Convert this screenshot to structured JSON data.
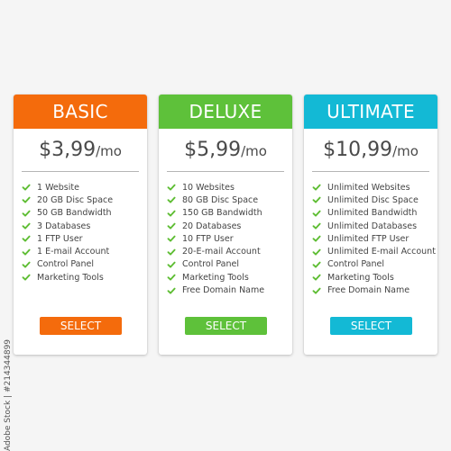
{
  "colors": {
    "basic": "#f46b0c",
    "deluxe": "#5ec13a",
    "ultimate": "#13b9d5",
    "check": "#5ebd33"
  },
  "plans": [
    {
      "name": "BASIC",
      "price": "$3,99",
      "unit": "/mo",
      "features": [
        "1 Website",
        "20 GB Disc Space",
        "50 GB Bandwidth",
        "3 Databases",
        "1 FTP User",
        "1 E-mail Account",
        "Control Panel",
        "Marketing Tools"
      ],
      "button_label": "SELECT"
    },
    {
      "name": "DELUXE",
      "price": "$5,99",
      "unit": "/mo",
      "features": [
        "10 Websites",
        "80 GB Disc Space",
        "150 GB Bandwidth",
        "20 Databases",
        "10 FTP User",
        "20-E-mail Account",
        "Control Panel",
        "Marketing Tools",
        "Free Domain Name"
      ],
      "button_label": "SELECT"
    },
    {
      "name": "ULTIMATE",
      "price": "$10,99",
      "unit": "/mo",
      "features": [
        "Unlimited Websites",
        "Unlimited Disc Space",
        "Unlimited Bandwidth",
        "Unlimited Databases",
        "Unlimited FTP User",
        "Unlimited E-mail Account",
        "Control Panel",
        "Marketing Tools",
        "Free Domain Name"
      ],
      "button_label": "SELECT"
    }
  ],
  "watermark": "Adobe Stock | #214344899"
}
